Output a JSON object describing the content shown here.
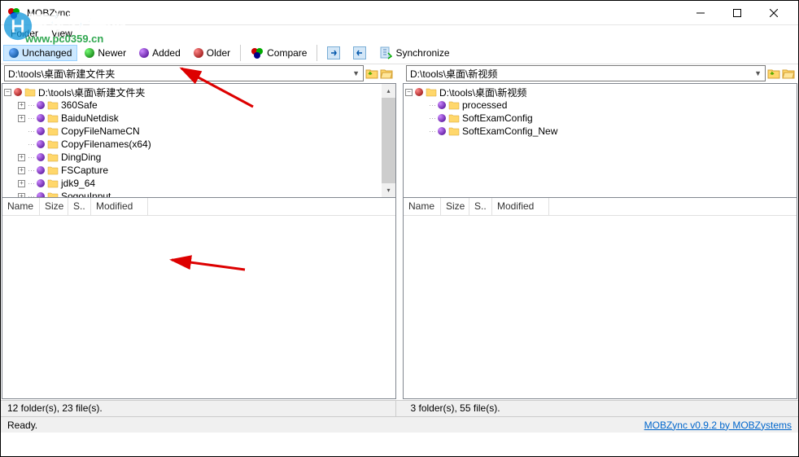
{
  "window": {
    "title": "MOBZync"
  },
  "menu": {
    "folder": "Folder",
    "view": "View"
  },
  "toolbar": {
    "unchanged": "Unchanged",
    "newer": "Newer",
    "added": "Added",
    "older": "Older",
    "compare": "Compare",
    "synchronize": "Synchronize"
  },
  "left": {
    "path": "D:\\tools\\桌面\\新建文件夹",
    "root": "D:\\tools\\桌面\\新建文件夹",
    "items": [
      {
        "name": "360Safe",
        "ball": "purple",
        "exp": "+"
      },
      {
        "name": "BaiduNetdisk",
        "ball": "purple",
        "exp": "+"
      },
      {
        "name": "CopyFileNameCN",
        "ball": "purple",
        "exp": ""
      },
      {
        "name": "CopyFilenames(x64)",
        "ball": "purple",
        "exp": ""
      },
      {
        "name": "DingDing",
        "ball": "purple",
        "exp": "+"
      },
      {
        "name": "FSCapture",
        "ball": "purple",
        "exp": "+"
      },
      {
        "name": "jdk9_64",
        "ball": "purple",
        "exp": "+"
      },
      {
        "name": "SogouInput",
        "ball": "purple",
        "exp": "+"
      }
    ],
    "status": "12 folder(s), 23 file(s)."
  },
  "right": {
    "path": "D:\\tools\\桌面\\新视频",
    "root": "D:\\tools\\桌面\\新视频",
    "items": [
      {
        "name": "processed",
        "ball": "purple",
        "exp": ""
      },
      {
        "name": "SoftExamConfig",
        "ball": "purple",
        "exp": ""
      },
      {
        "name": "SoftExamConfig_New",
        "ball": "purple",
        "exp": ""
      }
    ],
    "status": "3 folder(s), 55 file(s)."
  },
  "list_headers": {
    "name": "Name",
    "size": "Size",
    "s": "S..",
    "modified": "Modified"
  },
  "statusbar": {
    "ready": "Ready.",
    "version": "MOBZync v0.9.2 by MOBZystems"
  },
  "watermark": {
    "main": "河东软件园",
    "sub": "www.pc0359.cn"
  }
}
